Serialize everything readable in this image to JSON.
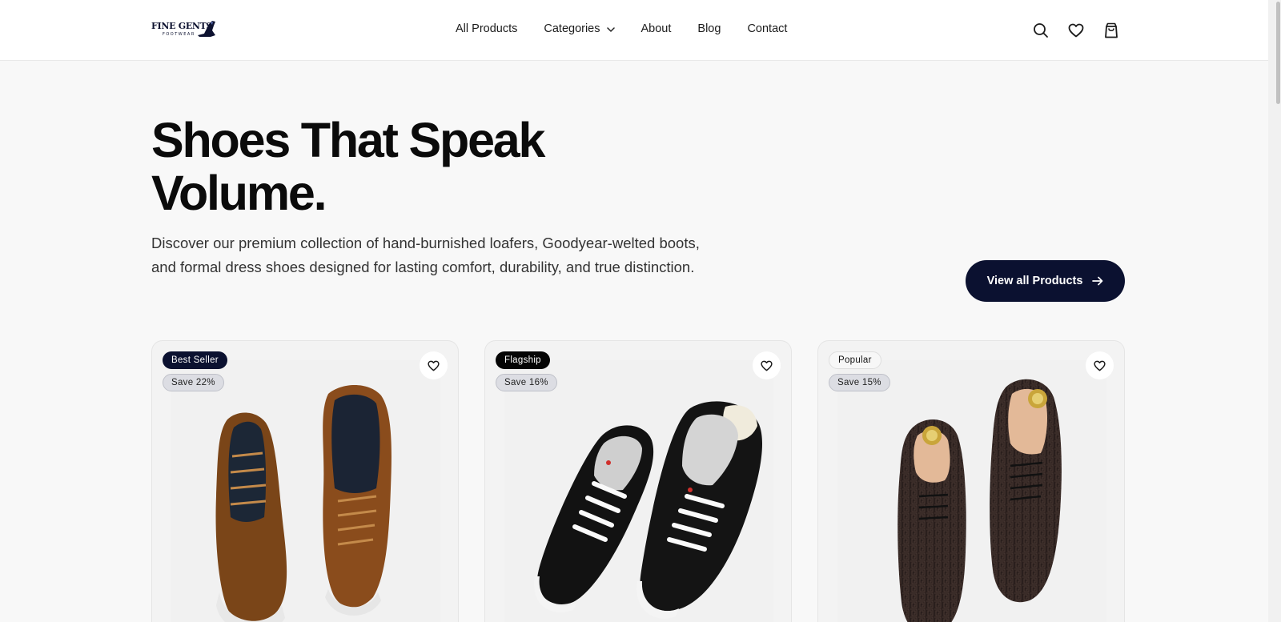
{
  "brand": {
    "logo_main": "FINE GENTS",
    "logo_sub": "FOOTWEAR"
  },
  "nav": {
    "items": [
      {
        "label": "All Products"
      },
      {
        "label": "Categories",
        "has_dropdown": true
      },
      {
        "label": "About"
      },
      {
        "label": "Blog"
      },
      {
        "label": "Contact"
      }
    ]
  },
  "header_icons": [
    "search-icon",
    "heart-icon",
    "shopping-bag-icon"
  ],
  "hero": {
    "title": "Shoes That Speak Volume.",
    "description": "Discover our premium collection of hand-burnished loafers, Goodyear-welted boots, and formal dress shoes designed for lasting comfort, durability, and true distinction.",
    "cta_label": "View all Products"
  },
  "products": [
    {
      "badge": "Best Seller",
      "badge_style": "dark",
      "save": "Save 22%",
      "image": "brown-leather-sneakers"
    },
    {
      "badge": "Flagship",
      "badge_style": "black",
      "save": "Save 16%",
      "image": "black-white-sneakers"
    },
    {
      "badge": "Popular",
      "badge_style": "light",
      "save": "Save 15%",
      "image": "embossed-oxford-shoes"
    }
  ],
  "colors": {
    "accent": "#0b1130",
    "page_bg": "#f8f8f8",
    "header_bg": "#ffffff"
  }
}
